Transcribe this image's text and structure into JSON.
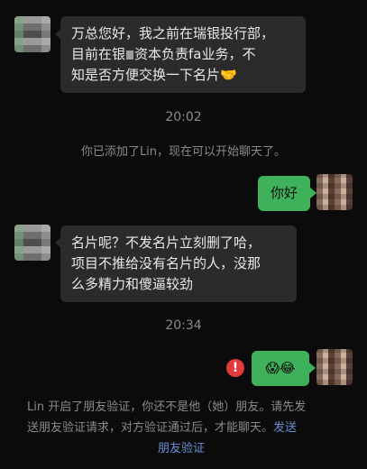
{
  "messages": {
    "first": {
      "line1": "万总您好，我之前在瑞银投行部，",
      "line2_a": "目前在银",
      "line2_b": "资本负责fa业务，不",
      "line3": "知是否方便交换一下名片🤝"
    },
    "time1": "20:02",
    "system1": "你已添加了Lin，现在可以开始聊天了。",
    "reply1": "你好",
    "second": {
      "line1": "名片呢？不发名片立刻删了哈，",
      "line2": "项目不推给没有名片的人，没那",
      "line3": "么多精力和傻逼较劲"
    },
    "time2": "20:34",
    "reply2": "😱😂",
    "error_mark": "!",
    "notice": {
      "line1": "Lin 开启了朋友验证，你还不是他（她）朋友。请先发",
      "line2": "送朋友验证请求，对方验证通过后，才能聊天。",
      "link_a": "发送",
      "link_b": "朋友验证"
    }
  },
  "colors": {
    "background": "#0b0b0b",
    "incoming_bubble": "#2b2b2b",
    "outgoing_bubble": "#3fb15a",
    "link": "#6a8fd6",
    "error": "#e23b3b"
  }
}
